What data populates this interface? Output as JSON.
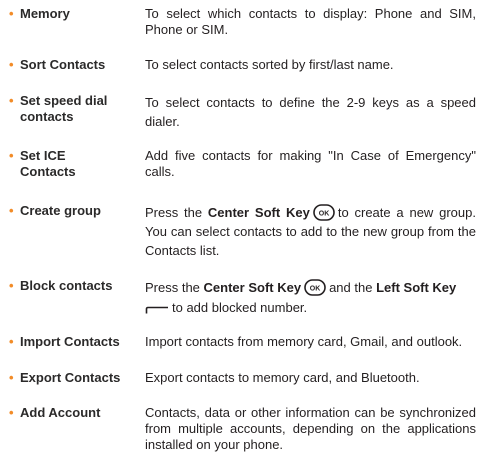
{
  "bullet": "•",
  "items": [
    {
      "term": "Memory",
      "desc": "To select which contacts to display: Phone and SIM, Phone or SIM."
    },
    {
      "term": "Sort Contacts",
      "desc": "To select contacts sorted by first/last name."
    },
    {
      "term_line1": "Set speed dial",
      "term_line2": "contacts",
      "desc": "To select contacts to define the 2-9 keys as a speed dialer."
    },
    {
      "term_line1": "Set ICE",
      "term_line2": "Contacts",
      "desc": "Add five contacts for making \"In Case of Emergency\" calls."
    },
    {
      "term": "Create group",
      "desc_pre": "Press the",
      "desc_bold": "Center Soft Key",
      "desc_post": "to create a new group. You can select contacts to add to the new group from the Contacts list."
    },
    {
      "term": "Block contacts",
      "desc_pre": "Press the",
      "desc_bold1": "Center Soft Key",
      "desc_mid": "and the",
      "desc_bold2": "Left Soft Key",
      "desc_post": "to add blocked number."
    },
    {
      "term": "Import Contacts",
      "desc": "Import contacts from memory card, Gmail, and outlook."
    },
    {
      "term": "Export Contacts",
      "desc": "Export contacts to memory card, and Bluetooth."
    },
    {
      "term": "Add Account",
      "desc": "Contacts, data or other information can be synchronized from multiple accounts, depending on the applications installed on your phone."
    }
  ],
  "ok_key_label": "OK",
  "icons": {
    "center_key": "center-soft-key-icon",
    "left_key": "left-soft-key-icon"
  },
  "colors": {
    "bullet": "#f28c28",
    "text": "#231f20"
  }
}
